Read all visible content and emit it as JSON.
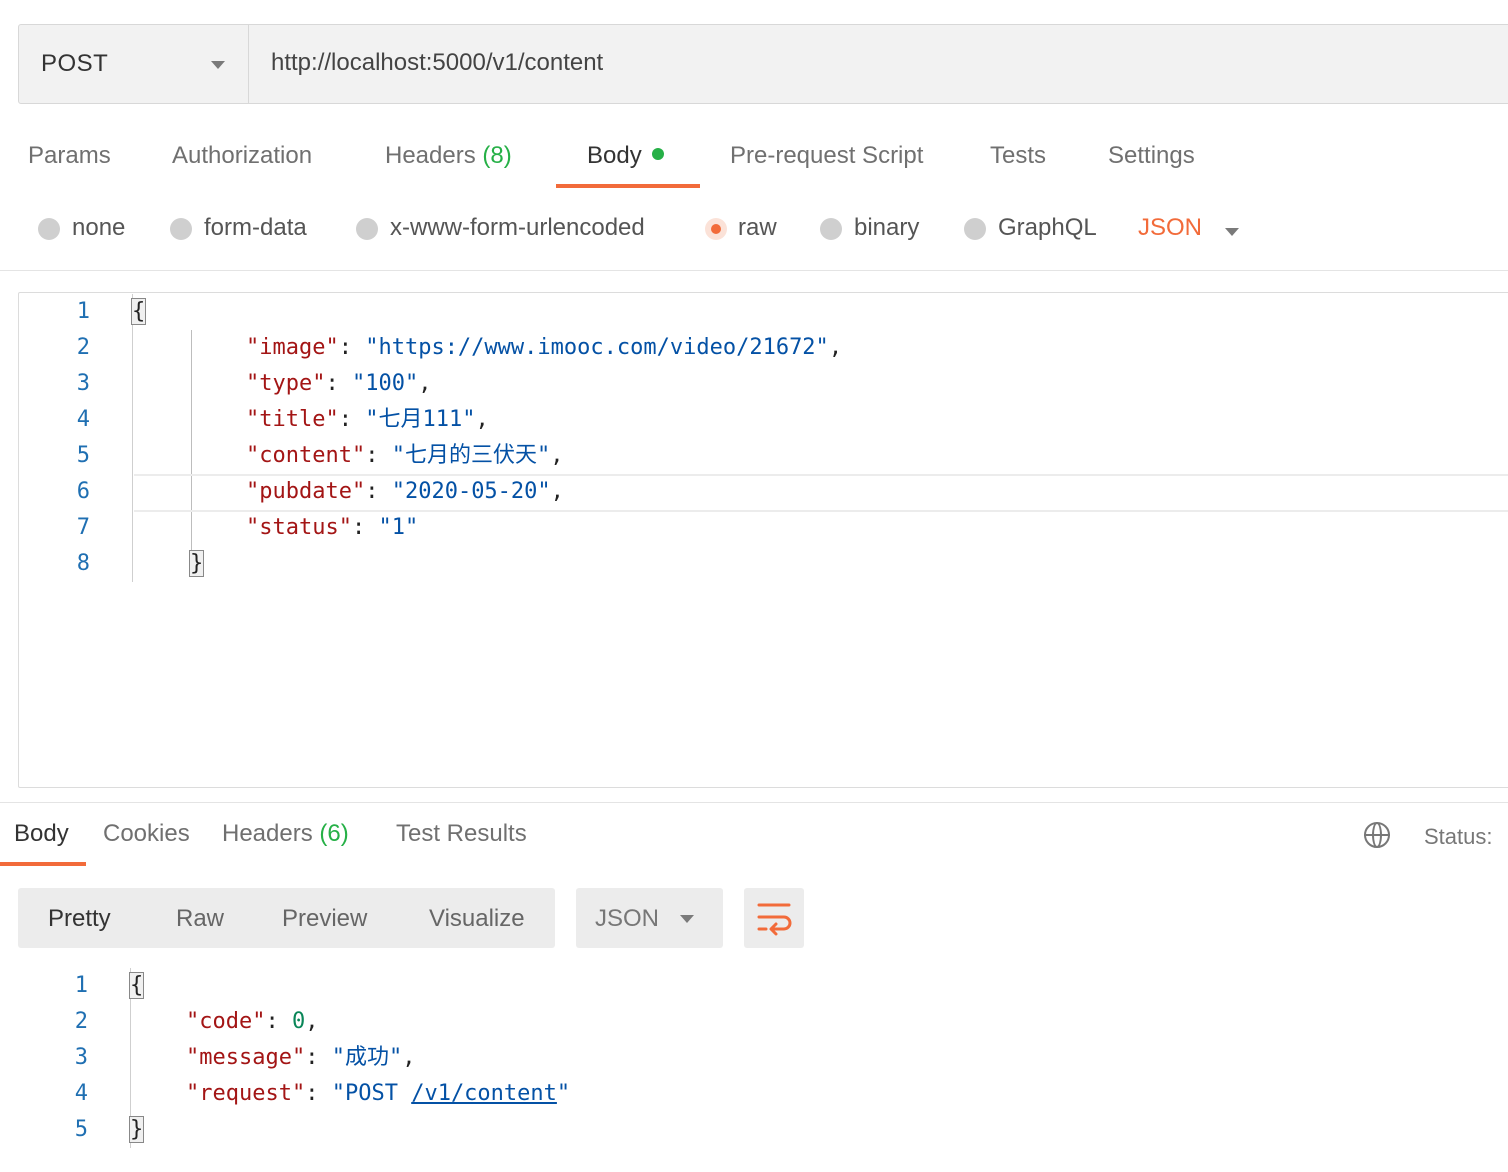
{
  "request": {
    "method": "POST",
    "url": "http://localhost:5000/v1/content"
  },
  "request_tabs": [
    {
      "label": "Params"
    },
    {
      "label": "Authorization"
    },
    {
      "label": "Headers",
      "count": "(8)"
    },
    {
      "label": "Body",
      "active": true,
      "indicator": "green-dot"
    },
    {
      "label": "Pre-request Script"
    },
    {
      "label": "Tests"
    },
    {
      "label": "Settings"
    }
  ],
  "body_types": [
    {
      "label": "none"
    },
    {
      "label": "form-data"
    },
    {
      "label": "x-www-form-urlencoded"
    },
    {
      "label": "raw",
      "selected": true
    },
    {
      "label": "binary"
    },
    {
      "label": "GraphQL"
    }
  ],
  "body_format": "JSON",
  "request_body_lines": [
    {
      "n": "1",
      "text": "{"
    },
    {
      "n": "2",
      "key": "\"image\"",
      "value": "\"https://www.imooc.com/video/21672\"",
      "trail": ","
    },
    {
      "n": "3",
      "key": "\"type\"",
      "value": "\"100\"",
      "trail": ","
    },
    {
      "n": "4",
      "key": "\"title\"",
      "value": "\"七月111\"",
      "trail": ","
    },
    {
      "n": "5",
      "key": "\"content\"",
      "value": "\"七月的三伏天\"",
      "trail": ","
    },
    {
      "n": "6",
      "key": "\"pubdate\"",
      "value": "\"2020-05-20\"",
      "trail": ","
    },
    {
      "n": "7",
      "key": "\"status\"",
      "value": "\"1\"",
      "trail": ""
    },
    {
      "n": "8",
      "text": "}"
    }
  ],
  "response_tabs": [
    {
      "label": "Body",
      "active": true
    },
    {
      "label": "Cookies"
    },
    {
      "label": "Headers",
      "count": "(6)"
    },
    {
      "label": "Test Results"
    }
  ],
  "status_label": "Status:",
  "view_modes": [
    "Pretty",
    "Raw",
    "Preview",
    "Visualize"
  ],
  "response_format": "JSON",
  "response_lines": [
    {
      "n": "1",
      "text": "{"
    },
    {
      "n": "2",
      "key": "\"code\"",
      "value": "0",
      "trail": ","
    },
    {
      "n": "3",
      "key": "\"message\"",
      "value": "\"成功\"",
      "trail": ","
    },
    {
      "n": "4",
      "key": "\"request\"",
      "value_prefix": "\"POST ",
      "value_link": "/v1/content",
      "value_suffix": "\""
    },
    {
      "n": "5",
      "text": "}"
    }
  ],
  "icons": {
    "method_dropdown": "chevron-down-icon",
    "format_dropdown": "chevron-down-icon",
    "status_globe": "globe-icon",
    "wrap": "wrap-lines-icon"
  },
  "colors": {
    "accent": "#f26b3a",
    "count_green": "#26b047",
    "json_key": "#a31515",
    "json_string": "#0451a5",
    "json_number": "#098658",
    "line_number": "#1f6fb2"
  }
}
